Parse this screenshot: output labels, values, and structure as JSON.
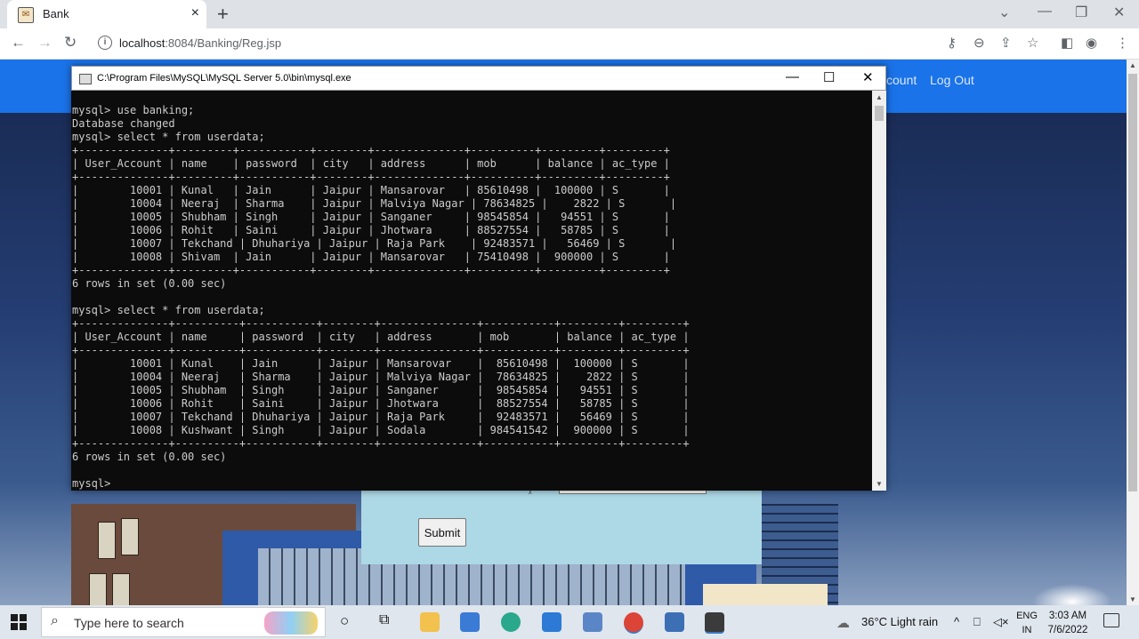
{
  "browser": {
    "tab_title": "Bank",
    "tab_close": "×",
    "new_tab": "+",
    "url_host": "localhost",
    "url_rest": ":8084/Banking/Reg.jsp"
  },
  "page": {
    "nav_partial": "count",
    "logout": "Log Out",
    "submit_label": "Submit",
    "form_dot": "ᵡ"
  },
  "console": {
    "title": "C:\\Program Files\\MySQL\\MySQL Server 5.0\\bin\\mysql.exe",
    "text": "mysql> use banking;\nDatabase changed\nmysql> select * from userdata;\n+--------------+---------+-----------+--------+--------------+----------+---------+---------+\n| User_Account | name    | password  | city   | address      | mob      | balance | ac_type |\n+--------------+---------+-----------+--------+--------------+----------+---------+---------+\n|        10001 | Kunal   | Jain      | Jaipur | Mansarovar   | 85610498 |  100000 | S       |\n|        10004 | Neeraj  | Sharma    | Jaipur | Malviya Nagar | 78634825 |    2822 | S       |\n|        10005 | Shubham | Singh     | Jaipur | Sanganer     | 98545854 |   94551 | S       |\n|        10006 | Rohit   | Saini     | Jaipur | Jhotwara     | 88527554 |   58785 | S       |\n|        10007 | Tekchand | Dhuhariya | Jaipur | Raja Park    | 92483571 |   56469 | S       |\n|        10008 | Shivam  | Jain      | Jaipur | Mansarovar   | 75410498 |  900000 | S       |\n+--------------+---------+-----------+--------+--------------+----------+---------+---------+\n6 rows in set (0.00 sec)\n\nmysql> select * from userdata;\n+--------------+----------+-----------+--------+---------------+-----------+---------+---------+\n| User_Account | name     | password  | city   | address       | mob       | balance | ac_type |\n+--------------+----------+-----------+--------+---------------+-----------+---------+---------+\n|        10001 | Kunal    | Jain      | Jaipur | Mansarovar    |  85610498 |  100000 | S       |\n|        10004 | Neeraj   | Sharma    | Jaipur | Malviya Nagar |  78634825 |    2822 | S       |\n|        10005 | Shubham  | Singh     | Jaipur | Sanganer      |  98545854 |   94551 | S       |\n|        10006 | Rohit    | Saini     | Jaipur | Jhotwara      |  88527554 |   58785 | S       |\n|        10007 | Tekchand | Dhuhariya | Jaipur | Raja Park     |  92483571 |   56469 | S       |\n|        10008 | Kushwant | Singh     | Jaipur | Sodala        | 984541542 |  900000 | S       |\n+--------------+----------+-----------+--------+---------------+-----------+---------+---------+\n6 rows in set (0.00 sec)\n\nmysql>"
  },
  "taskbar": {
    "search_placeholder": "Type here to search",
    "weather": "36°C  Light rain",
    "lang_top": "ENG",
    "lang_bottom": "IN",
    "time": "3:03 AM",
    "date": "7/6/2022"
  },
  "colors": {
    "navbar": "#1a73e8",
    "form_bg": "#add8e6",
    "console_bg": "#0c0c0c"
  }
}
